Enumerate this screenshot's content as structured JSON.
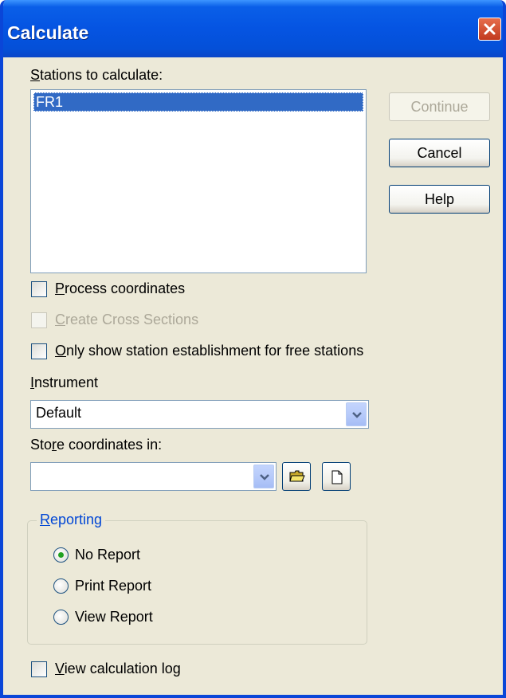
{
  "window": {
    "title": "Calculate"
  },
  "stations": {
    "label_pre": "",
    "label_u": "S",
    "label_post": "tations to calculate:",
    "items": [
      "FR1"
    ]
  },
  "buttons": {
    "continue": "Continue",
    "cancel": "Cancel",
    "help": "Help"
  },
  "options": {
    "process_u": "P",
    "process_post": "rocess coordinates",
    "cross_u": "C",
    "cross_post": "reate Cross Sections",
    "free_u": "O",
    "free_post": "nly show station establishment for free stations"
  },
  "instrument": {
    "label_u": "I",
    "label_post": "nstrument",
    "value": "Default"
  },
  "store": {
    "label_pre": "Sto",
    "label_u": "r",
    "label_post": "e coordinates in:",
    "value": ""
  },
  "reporting": {
    "legend_u": "R",
    "legend_post": "eporting",
    "options": [
      "No Report",
      "Print Report",
      "View Report"
    ],
    "selected": "No Report"
  },
  "log": {
    "label_u": "V",
    "label_post": "iew calculation log"
  },
  "colors": {
    "titlebar": "#0554e2",
    "selection": "#316ac5",
    "radio_dot": "#21a121",
    "group_legend": "#0046d5"
  },
  "icons": [
    "close-icon",
    "folder-open-icon",
    "new-file-icon",
    "chevron-down-icon"
  ]
}
